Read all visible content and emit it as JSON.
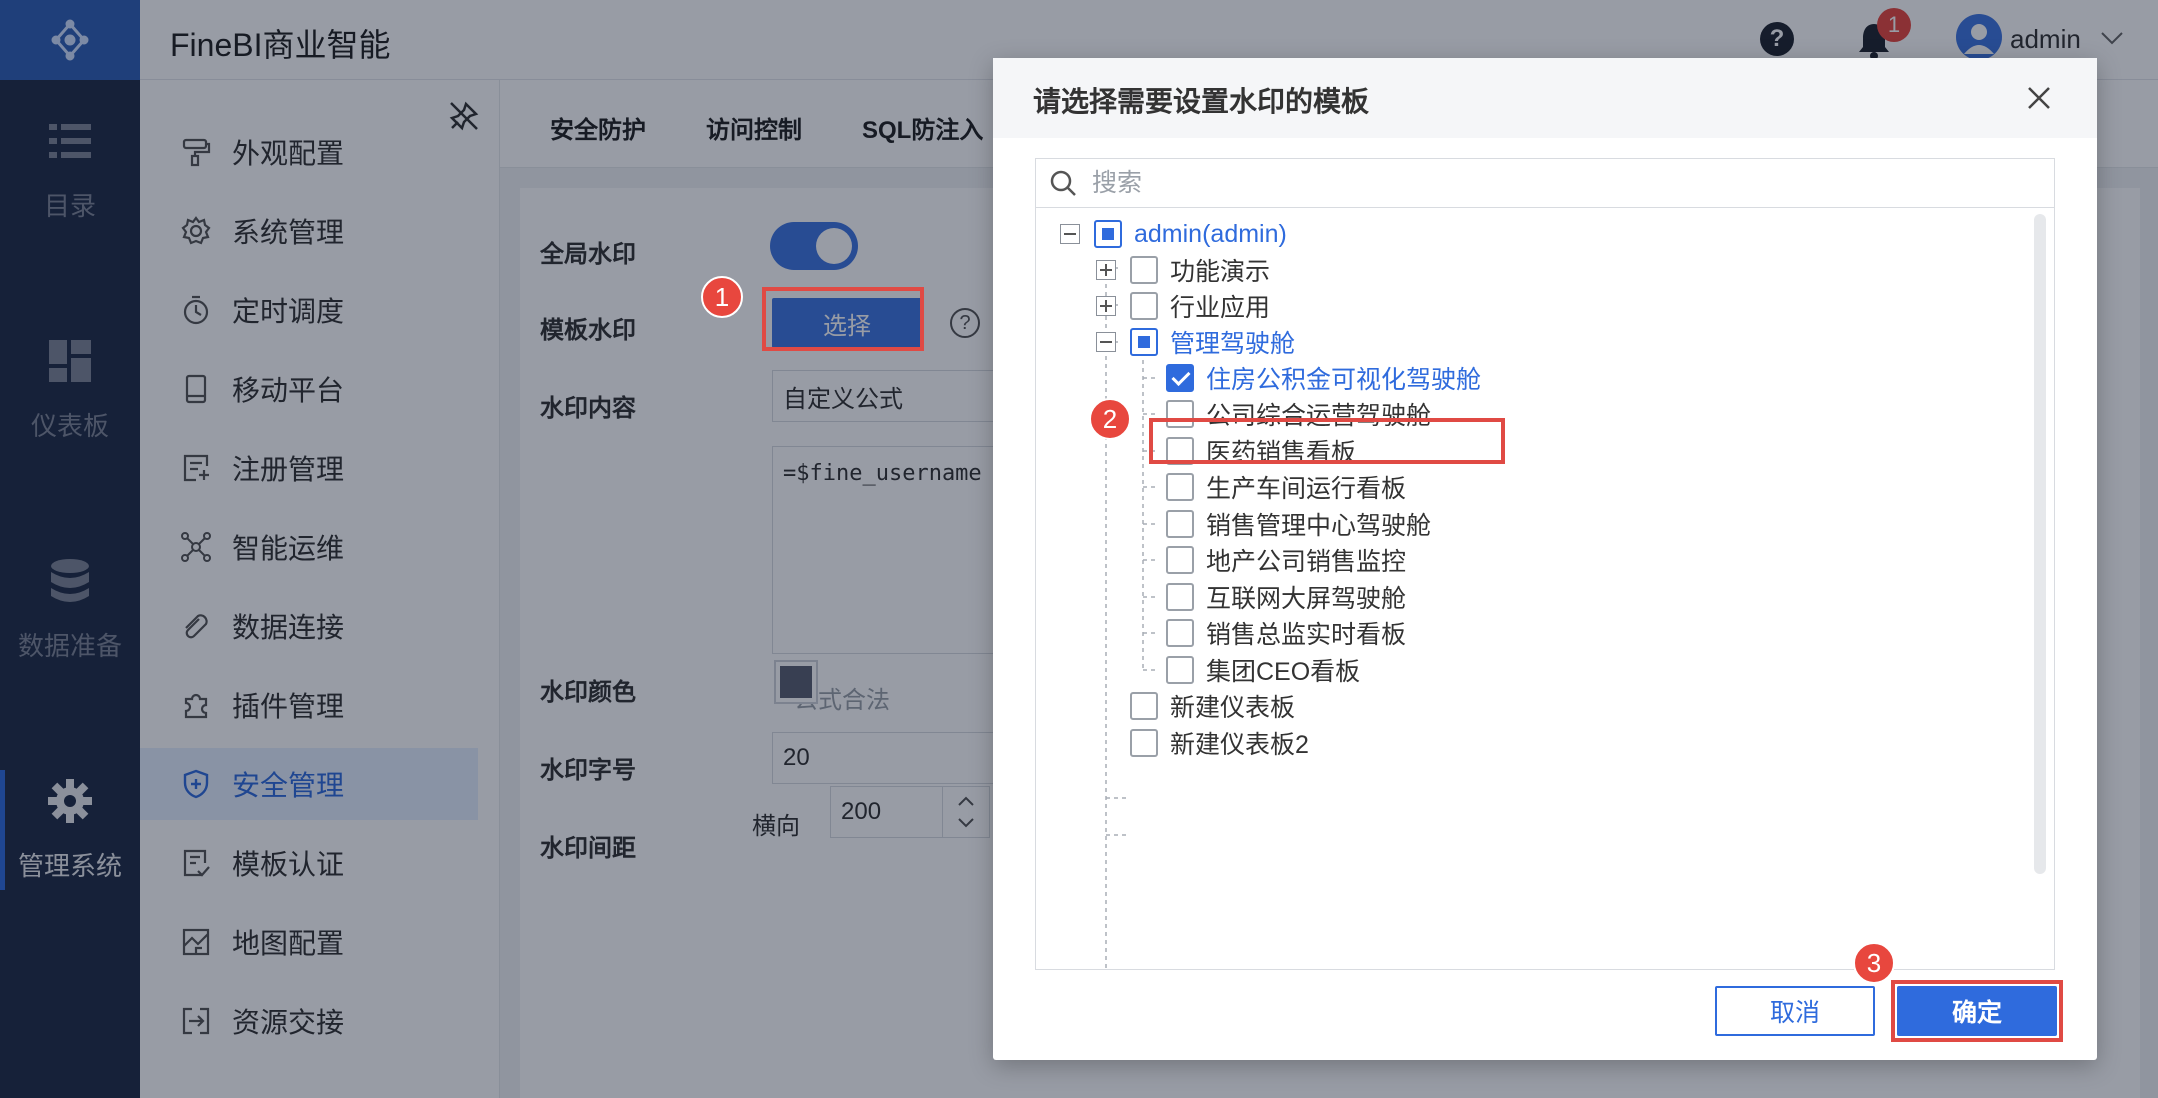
{
  "app": {
    "title": "FineBI商业智能",
    "user": "admin",
    "notification_count": "1"
  },
  "rail": [
    {
      "label": "目录",
      "icon": "catalog-icon"
    },
    {
      "label": "仪表板",
      "icon": "dashboard-icon"
    },
    {
      "label": "数据准备",
      "icon": "database-icon"
    },
    {
      "label": "管理系统",
      "icon": "gear-icon",
      "active": true
    }
  ],
  "sidebar": {
    "items": [
      {
        "label": "外观配置",
        "icon": "brush-icon"
      },
      {
        "label": "系统管理",
        "icon": "gear-icon"
      },
      {
        "label": "定时调度",
        "icon": "timer-icon"
      },
      {
        "label": "移动平台",
        "icon": "mobile-icon"
      },
      {
        "label": "注册管理",
        "icon": "register-icon"
      },
      {
        "label": "智能运维",
        "icon": "network-icon"
      },
      {
        "label": "数据连接",
        "icon": "link-icon"
      },
      {
        "label": "插件管理",
        "icon": "plugin-icon"
      },
      {
        "label": "安全管理",
        "icon": "shield-icon",
        "active": true
      },
      {
        "label": "模板认证",
        "icon": "certificate-icon"
      },
      {
        "label": "地图配置",
        "icon": "map-icon"
      },
      {
        "label": "资源交接",
        "icon": "handover-icon"
      }
    ]
  },
  "main": {
    "tabs": [
      "安全防护",
      "访问控制",
      "SQL防注入"
    ],
    "form": {
      "global_watermark_label": "全局水印",
      "template_watermark_label": "模板水印",
      "select_button": "选择",
      "content_label": "水印内容",
      "content_value": "自定义公式",
      "formula_value": "=$fine_username",
      "formula_hint": "公式合法",
      "color_label": "水印颜色",
      "font_size_label": "水印字号",
      "font_size_value": "20",
      "spacing_label": "水印间距",
      "spacing_horizontal_label": "横向",
      "spacing_horizontal_value": "200"
    }
  },
  "modal": {
    "title": "请选择需要设置水印的模板",
    "search_placeholder": "搜索",
    "tree": {
      "root": "admin(admin)",
      "folders": [
        "功能演示",
        "行业应用",
        "管理驾驶舱"
      ],
      "cockpit_children": [
        {
          "label": "住房公积金可视化驾驶舱",
          "checked": true
        },
        {
          "label": "公司综合运营驾驶舱",
          "checked": false
        },
        {
          "label": "医药销售看板",
          "checked": false
        },
        {
          "label": "生产车间运行看板",
          "checked": false
        },
        {
          "label": "销售管理中心驾驶舱",
          "checked": false
        },
        {
          "label": "地产公司销售监控",
          "checked": false
        },
        {
          "label": "互联网大屏驾驶舱",
          "checked": false
        },
        {
          "label": "销售总监实时看板",
          "checked": false
        },
        {
          "label": "集团CEO看板",
          "checked": false
        }
      ],
      "root_dashboards": [
        "新建仪表板",
        "新建仪表板2"
      ]
    },
    "cancel": "取消",
    "confirm": "确定"
  },
  "annotations": {
    "step1": "1",
    "step2": "2",
    "step3": "3"
  },
  "colors": {
    "primary": "#2f6bdd",
    "annotation_red": "#e04a44",
    "rail_bg": "#1f2b45"
  }
}
